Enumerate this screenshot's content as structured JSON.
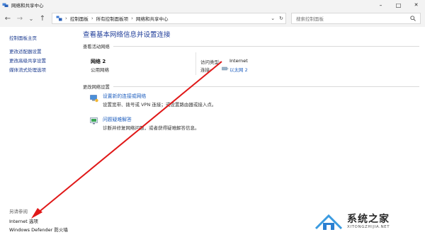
{
  "window": {
    "title": "网络和共享中心",
    "minimize_glyph": "–",
    "maximize_glyph": "□",
    "close_glyph": "✕"
  },
  "nav": {
    "back_glyph": "←",
    "forward_glyph": "→",
    "dropdown_glyph": "⌄",
    "up_glyph": "↑",
    "breadcrumbs": [
      "控制面板",
      "所有控制面板项",
      "网络和共享中心"
    ],
    "sep_glyph": "›",
    "refresh_glyph": "↻",
    "search_placeholder": "搜索控制面板"
  },
  "sidebar": {
    "home_link": "控制面板主页",
    "links": [
      "更改适配器设置",
      "更改高级共享设置",
      "媒体流式处理选项"
    ],
    "see_also_heading": "另请参阅",
    "see_also": [
      "Internet 选项",
      "Windows Defender 防火墙"
    ]
  },
  "main": {
    "title": "查看基本网络信息并设置连接",
    "active_networks_label": "查看活动网络",
    "network": {
      "name": "网络 2",
      "type": "公用网络",
      "access_type_label": "访问类型:",
      "access_type_value": "Internet",
      "connections_label": "连接:",
      "connection_value": "以太网 2"
    },
    "change_settings_label": "更改网络设置",
    "tasks": [
      {
        "link": "设置新的连接或网络",
        "desc": "设置宽带、拨号或 VPN 连接；或设置路由器或接入点。",
        "icon": "new-connection-icon"
      },
      {
        "link": "问题疑难解答",
        "desc": "诊断并修复网络问题，或者获得疑难解答信息。",
        "icon": "troubleshoot-icon"
      }
    ]
  },
  "watermark": {
    "title": "系统之家",
    "url": "XITONGZHIJIA.NET"
  },
  "colors": {
    "link": "#1f5fbf",
    "sidebar_link": "#1a3a8f",
    "title": "#1f3d99",
    "arrow": "#e01818"
  }
}
